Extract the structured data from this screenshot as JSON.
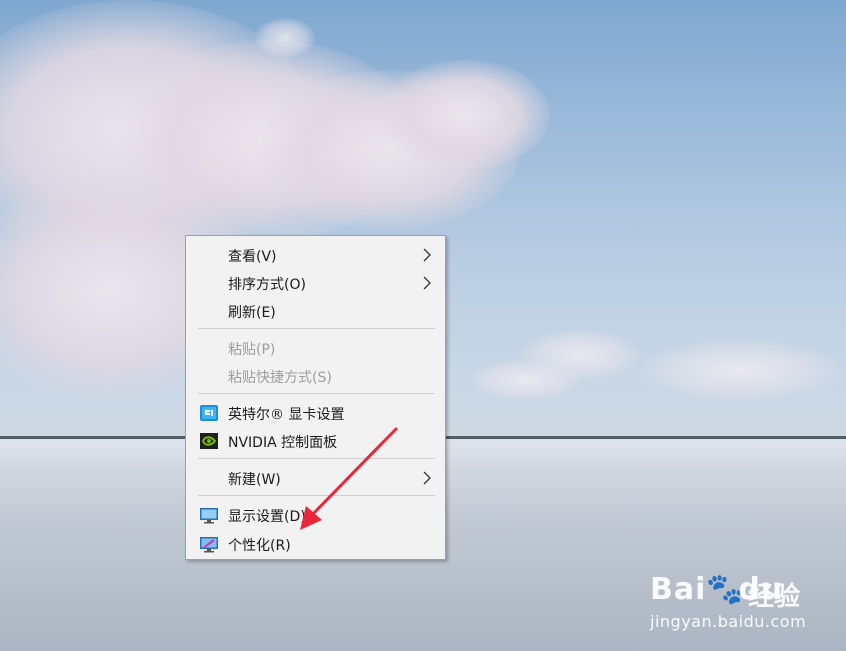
{
  "context_menu": {
    "items": [
      {
        "label": "查看(V)",
        "submenu": true,
        "disabled": false
      },
      {
        "label": "排序方式(O)",
        "submenu": true,
        "disabled": false
      },
      {
        "label": "刷新(E)",
        "submenu": false,
        "disabled": false
      },
      {
        "label": "粘贴(P)",
        "submenu": false,
        "disabled": true
      },
      {
        "label": "粘贴快捷方式(S)",
        "submenu": false,
        "disabled": true
      },
      {
        "label": "英特尔® 显卡设置",
        "submenu": false,
        "disabled": false,
        "icon": "intel-graphics-icon"
      },
      {
        "label": "NVIDIA 控制面板",
        "submenu": false,
        "disabled": false,
        "icon": "nvidia-icon"
      },
      {
        "label": "新建(W)",
        "submenu": true,
        "disabled": false
      },
      {
        "label": "显示设置(D)",
        "submenu": false,
        "disabled": false,
        "icon": "display-settings-icon"
      },
      {
        "label": "个性化(R)",
        "submenu": false,
        "disabled": false,
        "icon": "personalize-icon"
      }
    ]
  },
  "annotation": {
    "arrow_color": "#e8283a",
    "points_to": "个性化(R)"
  },
  "watermark": {
    "brand": "Bai",
    "brand_suffix": "du",
    "product": "经验",
    "url": "jingyan.baidu.com"
  },
  "colors": {
    "menu_bg": "#f2f2f2",
    "disabled_text": "#9d9d9d"
  }
}
